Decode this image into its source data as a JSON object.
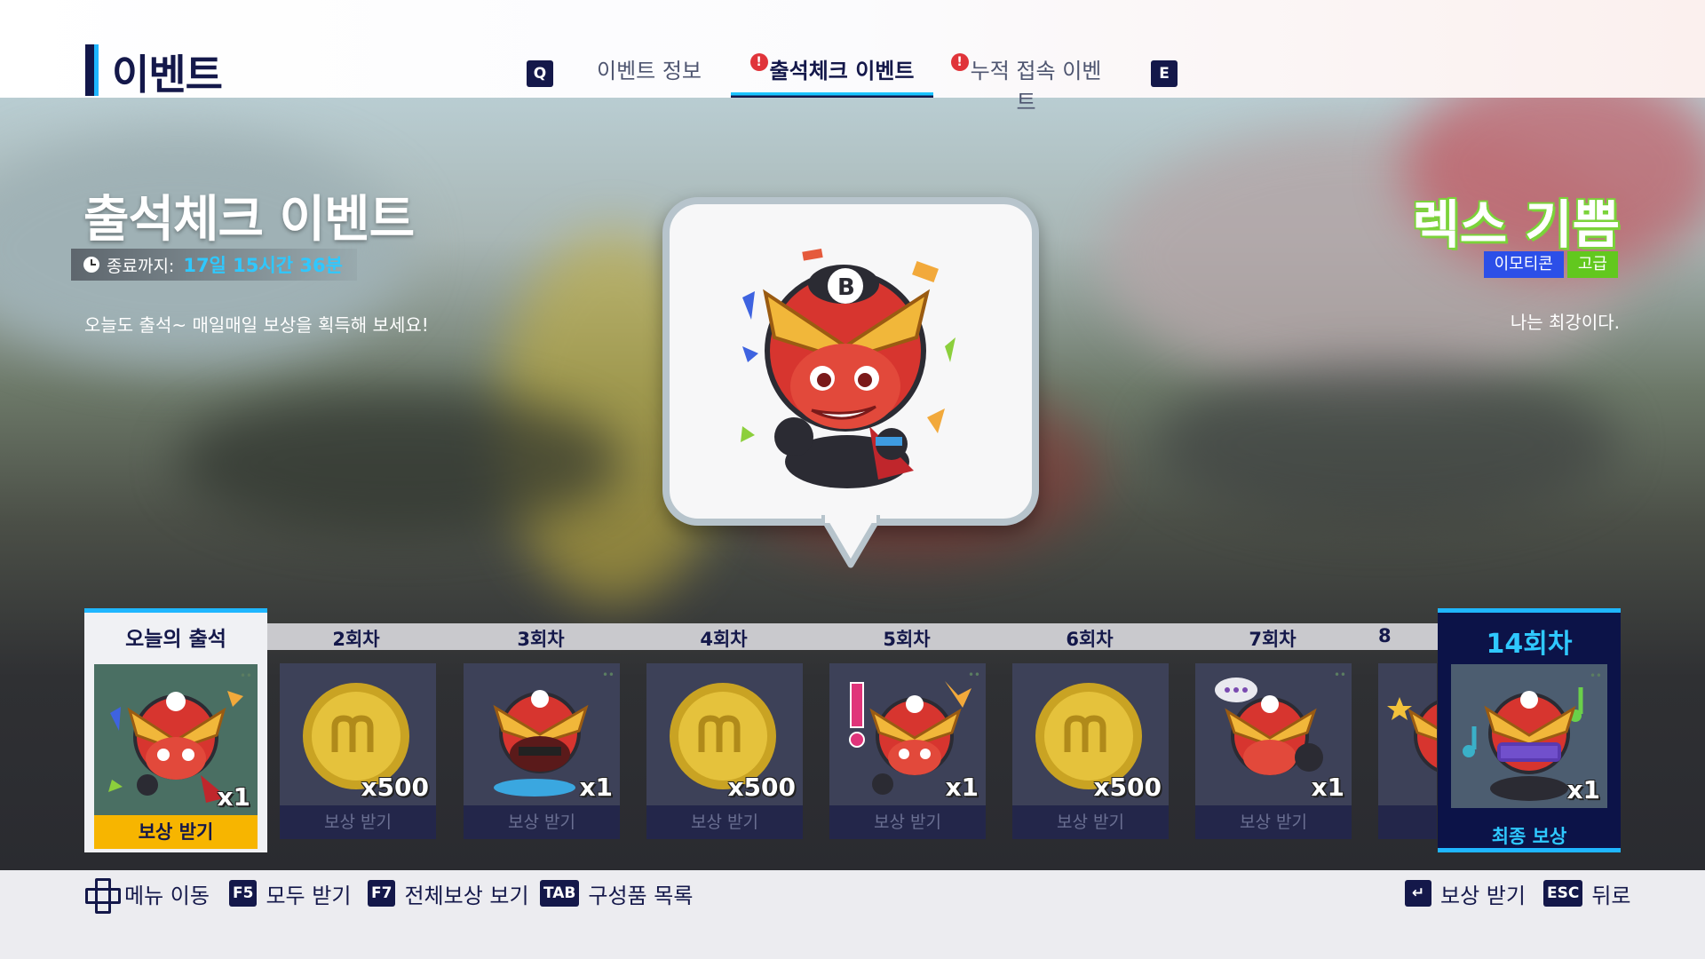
{
  "header": {
    "title": "이벤트",
    "prev_key": "Q",
    "next_key": "E",
    "tabs": [
      {
        "label": "이벤트 정보",
        "alert": false
      },
      {
        "label": "출석체크 이벤트",
        "alert": true
      },
      {
        "label": "누적 접속 이벤트",
        "alert": true
      }
    ],
    "active_tab_index": 1,
    "alert_mark": "!"
  },
  "event": {
    "title": "출석체크 이벤트",
    "timer_label": "종료까지:",
    "timer_value": "17일 15시간 36분",
    "description": "오늘도 출석~ 매일매일 보상을 획득해 보세요!"
  },
  "item": {
    "name": "렉스 기쁨",
    "category": "이모티콘",
    "grade": "고급",
    "description": "나는 최강이다."
  },
  "rewards": {
    "today": {
      "label": "오늘의 출석",
      "qty": "x1",
      "button": "보상 받기",
      "icon": "rex-joy-emoticon"
    },
    "days": [
      {
        "label": "2회차",
        "qty": "x500",
        "button": "보상 받기",
        "icon": "gold-coin"
      },
      {
        "label": "3회차",
        "qty": "x1",
        "button": "보상 받기",
        "icon": "rex-sad-emoticon"
      },
      {
        "label": "4회차",
        "qty": "x500",
        "button": "보상 받기",
        "icon": "gold-coin"
      },
      {
        "label": "5회차",
        "qty": "x1",
        "button": "보상 받기",
        "icon": "rex-angry-emoticon"
      },
      {
        "label": "6회차",
        "qty": "x500",
        "button": "보상 받기",
        "icon": "gold-coin"
      },
      {
        "label": "7회차",
        "qty": "x1",
        "button": "보상 받기",
        "icon": "rex-chat-emoticon"
      },
      {
        "label": "8",
        "qty": "",
        "button": "보",
        "icon": "rex-star-emoticon"
      }
    ],
    "final": {
      "label": "14회차",
      "qty": "x1",
      "button": "최종 보상",
      "icon": "rex-music-emoticon"
    }
  },
  "footer": {
    "hints_left": [
      {
        "key": "",
        "label": "메뉴 이동",
        "icon": "dpad-icon"
      },
      {
        "key": "F5",
        "label": "모두 받기"
      },
      {
        "key": "F7",
        "label": "전체보상 보기"
      },
      {
        "key": "TAB",
        "label": "구성품 목록"
      }
    ],
    "hints_right": [
      {
        "key": "↵",
        "label": "보상 받기"
      },
      {
        "key": "ESC",
        "label": "뒤로"
      }
    ]
  },
  "colors": {
    "navy": "#14184a",
    "accent_cyan": "#1fb6ff",
    "claim_yellow": "#f7b500",
    "tag_blue": "#2c4fe8",
    "tag_green": "#62c81e"
  }
}
